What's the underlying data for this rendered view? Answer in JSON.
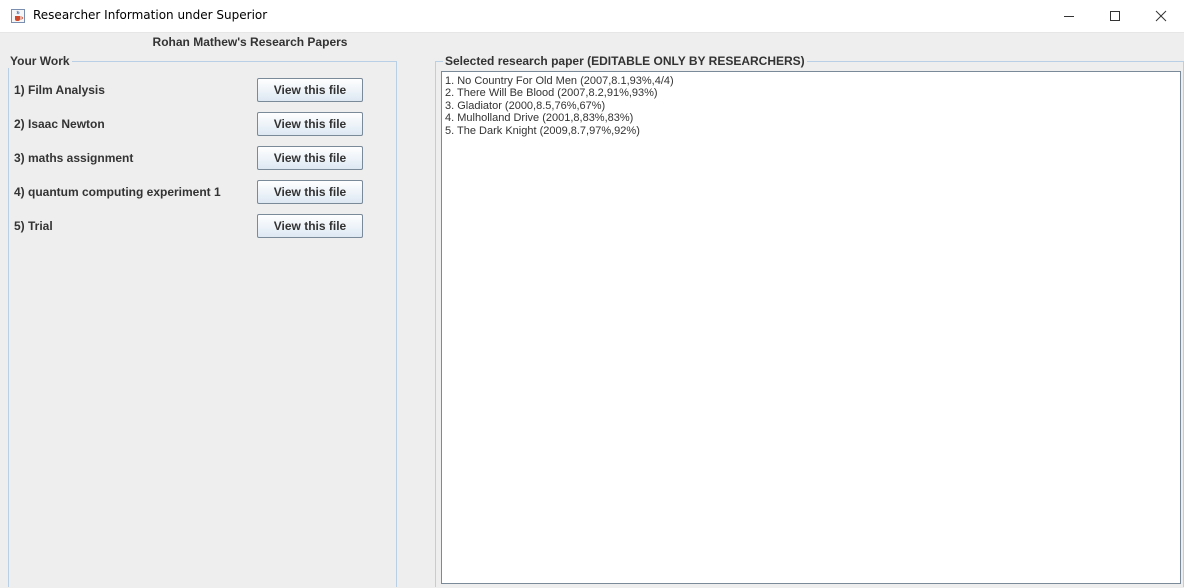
{
  "window": {
    "title": "Researcher Information under Superior",
    "icon": "java-cup-icon"
  },
  "header": {
    "label": "Rohan Mathew's Research Papers"
  },
  "left_panel": {
    "legend": "Your Work",
    "items": [
      {
        "label": "1) Film Analysis",
        "button": "View this file"
      },
      {
        "label": "2) Isaac Newton",
        "button": "View this file"
      },
      {
        "label": "3) maths assignment",
        "button": "View this file"
      },
      {
        "label": "4) quantum computing experiment 1",
        "button": "View this file"
      },
      {
        "label": "5) Trial",
        "button": "View this file"
      }
    ]
  },
  "right_panel": {
    "legend": "Selected research paper (EDITABLE ONLY BY RESEARCHERS)",
    "lines": [
      "1. No Country For Old Men (2007,8.1,93%,4/4)",
      "2. There Will Be Blood (2007,8.2,91%,93%)",
      "3. Gladiator (2000,8.5,76%,67%)",
      "4. Mulholland Drive (2001,8,83%,83%)",
      "5. The Dark Knight (2009,8.7,97%,92%)"
    ]
  },
  "colors": {
    "background": "#eeeeee",
    "border": "#b8cfe5",
    "button_gradient_bottom": "#dde8f3"
  }
}
